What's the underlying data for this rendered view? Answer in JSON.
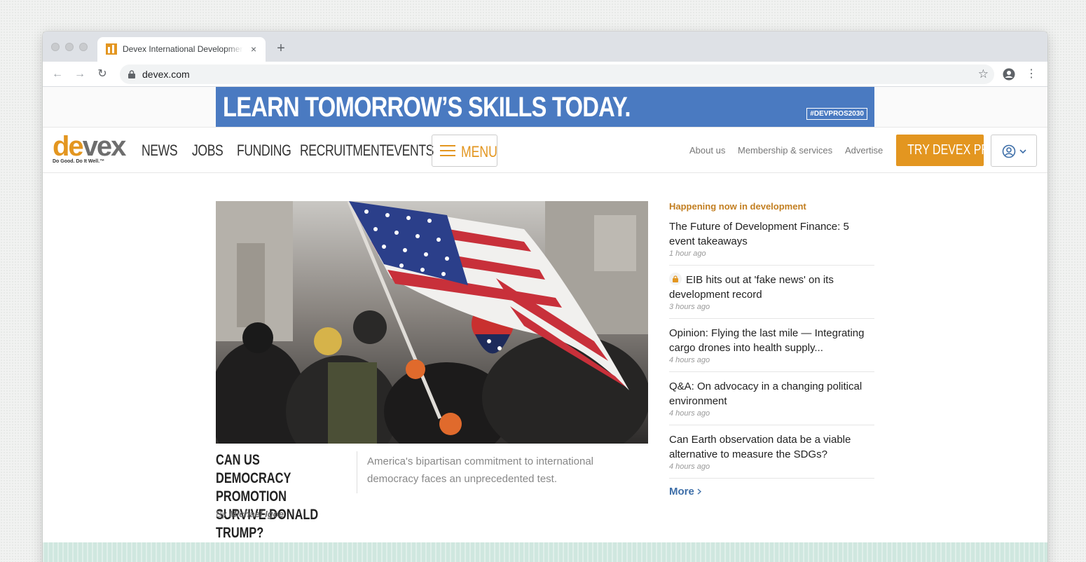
{
  "browser": {
    "tab_title": "Devex International Development",
    "tab_close": "×",
    "new_tab": "+",
    "back": "←",
    "forward": "→",
    "reload": "↻",
    "url": "devex.com",
    "star": "☆",
    "menu": "⋮"
  },
  "ad": {
    "headline": "LEARN TOMORROW’S SKILLS TODAY.",
    "hashtag": "#DEVPROS2030"
  },
  "header": {
    "logo_de": "de",
    "logo_vex": "vex",
    "logo_tagline": "Do Good. Do It Well.™",
    "nav": [
      "NEWS",
      "JOBS",
      "FUNDING",
      "RECRUITMENT",
      "EVENTS"
    ],
    "menu_label": "MENU",
    "secondary": [
      "About us",
      "Membership & services",
      "Advertise"
    ],
    "cta": "TRY DEVEX PRO"
  },
  "hero": {
    "title": "CAN US DEMOCRACY PROMOTION SURVIVE DONALD TRUMP?",
    "byline_prefix": "By",
    "author": "Michael Igoe",
    "summary": "America's bipartisan commitment to international democracy faces an unprecedented test."
  },
  "sidebar": {
    "heading": "Happening now in development",
    "items": [
      {
        "title": "The Future of Development Finance: 5 event takeaways",
        "time": "1 hour ago",
        "locked": false
      },
      {
        "title": "EIB hits out at 'fake news' on its development record",
        "time": "3 hours ago",
        "locked": true
      },
      {
        "title": "Opinion: Flying the last mile — Integrating cargo drones into health supply...",
        "time": "4 hours ago",
        "locked": false
      },
      {
        "title": "Q&A: On advocacy in a changing political environment",
        "time": "4 hours ago",
        "locked": false
      },
      {
        "title": "Can Earth observation data be a viable alternative to measure the SDGs?",
        "time": "4 hours ago",
        "locked": false
      }
    ],
    "more": "More"
  },
  "colors": {
    "brand_orange": "#e39620",
    "link_blue": "#3d6ea8",
    "ad_blue": "#4a7ac1"
  }
}
